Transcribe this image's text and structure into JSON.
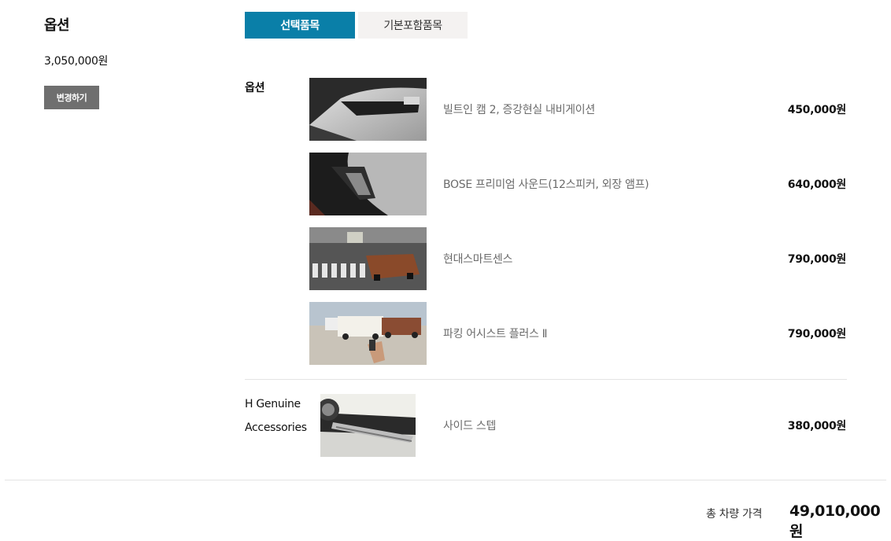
{
  "summary": {
    "title": "옵션",
    "price": "3,050,000원",
    "change_label": "변경하기"
  },
  "tabs": [
    {
      "label": "선택품목",
      "active": true
    },
    {
      "label": "기본포함품목",
      "active": false
    }
  ],
  "sections": {
    "options_label": "옵션",
    "accessories_label_line1": "H Genuine",
    "accessories_label_line2": "Accessories"
  },
  "options": [
    {
      "name": "빌트인 캠 2, 증강현실 내비게이션",
      "price": "450,000원",
      "image_icon": "dashcam-photo"
    },
    {
      "name": "BOSE 프리미엄 사운드(12스피커, 외장 앰프)",
      "price": "640,000원",
      "image_icon": "speaker-photo"
    },
    {
      "name": "현대스마트센스",
      "price": "790,000원",
      "image_icon": "smart-sense-photo"
    },
    {
      "name": "파킹 어시스트 플러스 Ⅱ",
      "price": "790,000원",
      "image_icon": "parking-assist-photo"
    }
  ],
  "accessories": [
    {
      "name": "사이드 스텝",
      "price": "380,000원",
      "image_icon": "side-step-photo"
    }
  ],
  "total": {
    "label": "총 차량 가격",
    "value": "49,010,000 원"
  },
  "colors": {
    "accent": "#0a7fa8",
    "button_gray": "#6f6f6f",
    "tab_inactive_bg": "#f4f2f1"
  }
}
